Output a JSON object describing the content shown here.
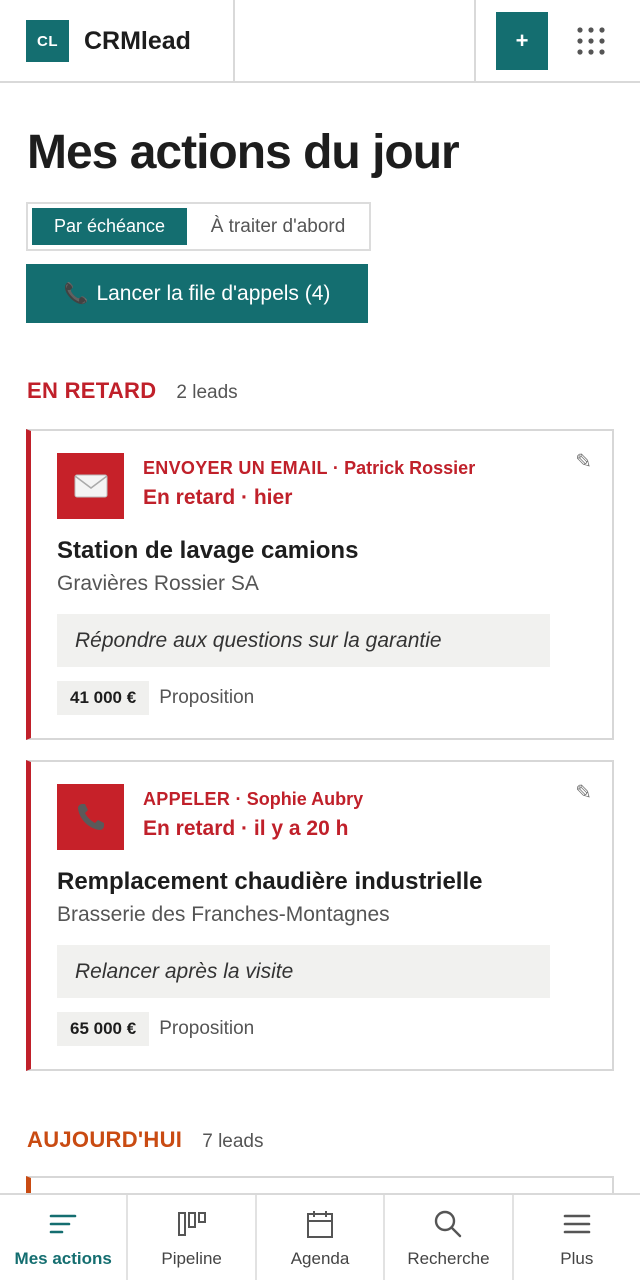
{
  "header": {
    "logo_initials": "CL",
    "app_name": "CRMlead",
    "add_label": "+",
    "accent_color": "#146e70"
  },
  "page": {
    "title": "Mes actions du jour"
  },
  "sort_toggle": {
    "options": [
      "Par échéance",
      "À traiter d'abord"
    ],
    "selected": "Par échéance"
  },
  "call_queue": {
    "icon": "phone-icon",
    "label": "Lancer la file d'appels (4)"
  },
  "sections": [
    {
      "label": "EN RETARD",
      "count": "2 leads",
      "color": "#c0202a",
      "cards": [
        {
          "icon": "envelope-icon",
          "action": "ENVOYER UN EMAIL",
          "separator": "·",
          "contact": "Patrick Rossier",
          "due": "En retard · hier",
          "title": "Station de lavage camions",
          "company": "Gravières Rossier SA",
          "note": "Répondre aux questions sur la garantie",
          "amount": "41 000 €",
          "stage": "Proposition"
        },
        {
          "icon": "phone-icon",
          "action": "APPELER",
          "separator": "·",
          "contact": "Sophie Aubry",
          "due": "En retard · il y a 20 h",
          "title": "Remplacement chaudière industrielle",
          "company": "Brasserie des Franches-Montagnes",
          "note": "Relancer après la visite",
          "amount": "65 000 €",
          "stage": "Proposition"
        }
      ]
    },
    {
      "label": "AUJOURD'HUI",
      "count": "7 leads",
      "color": "#c94b12"
    }
  ],
  "bottom_nav": {
    "items": [
      {
        "label": "Mes actions",
        "icon": "actions-list-icon",
        "active": true
      },
      {
        "label": "Pipeline",
        "icon": "pipeline-icon",
        "active": false
      },
      {
        "label": "Agenda",
        "icon": "calendar-icon",
        "active": false
      },
      {
        "label": "Recherche",
        "icon": "search-icon",
        "active": false
      },
      {
        "label": "Plus",
        "icon": "menu-icon",
        "active": false
      }
    ]
  }
}
